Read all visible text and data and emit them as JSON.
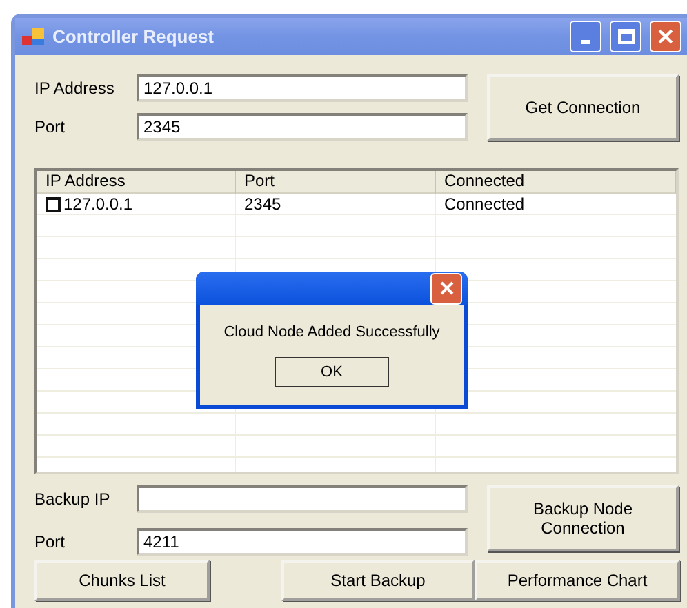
{
  "window": {
    "title": "Controller Request"
  },
  "connection": {
    "ip_label": "IP Address",
    "ip_value": "127.0.0.1",
    "port_label": "Port",
    "port_value": "2345",
    "button": "Get Connection"
  },
  "table": {
    "columns": [
      "IP Address",
      "Port",
      "Connected"
    ],
    "rows": [
      {
        "checked": false,
        "ip": "127.0.0.1",
        "port": "2345",
        "connected": "Connected"
      }
    ]
  },
  "dialog": {
    "message": "Cloud Node Added Successfully",
    "button": "OK"
  },
  "backup": {
    "ip_label": "Backup IP",
    "port_label": "Port",
    "port_value": "4211",
    "button": "Backup Node Connection"
  },
  "buttons": [
    "Chunks List",
    "Start Backup",
    "Performance Chart"
  ]
}
